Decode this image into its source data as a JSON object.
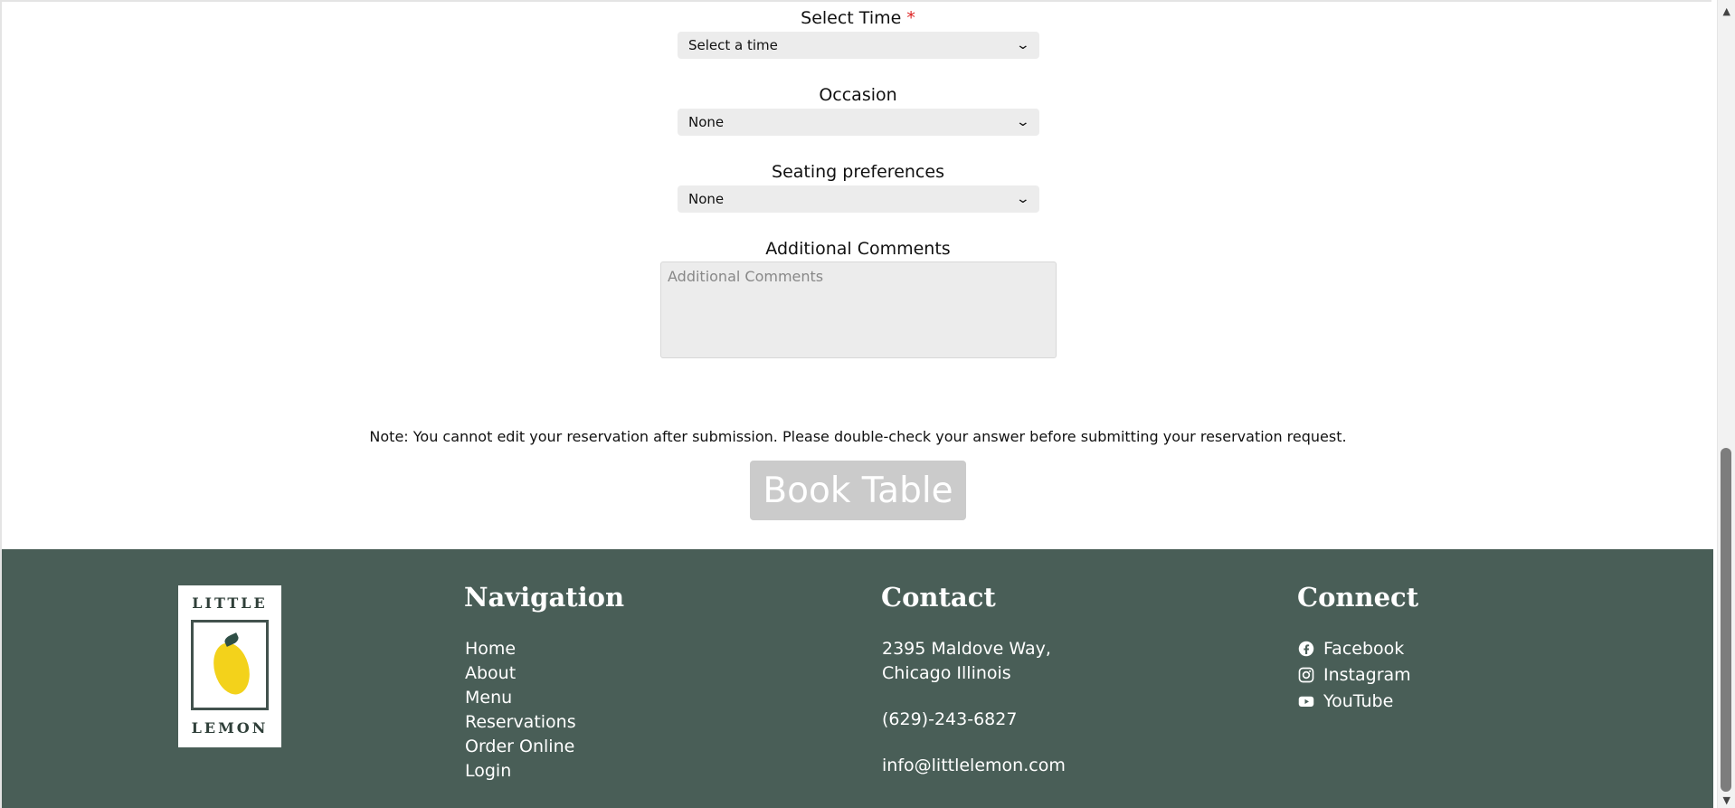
{
  "form": {
    "time": {
      "label": "Select Time",
      "required_mark": "*",
      "value": "Select a time"
    },
    "occasion": {
      "label": "Occasion",
      "value": "None"
    },
    "seating": {
      "label": "Seating preferences",
      "value": "None"
    },
    "comments": {
      "label": "Additional Comments",
      "placeholder": "Additional Comments"
    },
    "note": "Note: You cannot edit your reservation after submission. Please double-check your answer before submitting your reservation request.",
    "button": "Book Table"
  },
  "footer": {
    "logo": {
      "top": "LITTLE",
      "bottom": "LEMON"
    },
    "navigation": {
      "title": "Navigation",
      "items": [
        "Home",
        "About",
        "Menu",
        "Reservations",
        "Order Online",
        "Login"
      ]
    },
    "contact": {
      "title": "Contact",
      "address_line1": "2395 Maldove Way,",
      "address_line2": "Chicago Illinois",
      "phone": "(629)-243-6827",
      "email": "info@littlelemon.com"
    },
    "connect": {
      "title": "Connect",
      "items": [
        {
          "label": "Facebook",
          "icon": "facebook-icon"
        },
        {
          "label": "Instagram",
          "icon": "instagram-icon"
        },
        {
          "label": "YouTube",
          "icon": "youtube-icon"
        }
      ]
    }
  }
}
